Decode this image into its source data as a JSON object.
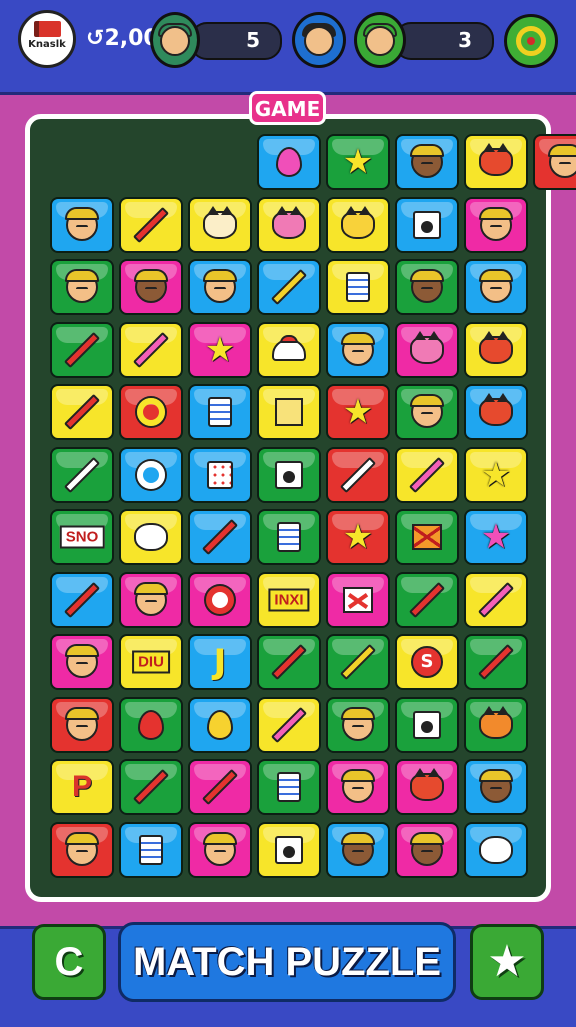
{
  "header": {
    "logo_text": "Knaslk",
    "coin_label": "2,00",
    "player1": {
      "count": "5"
    },
    "player2": {
      "count": "3"
    }
  },
  "game_tag": "GAME",
  "bottom": {
    "left_button": "C",
    "title": "MATCH PUZZLE",
    "right_button": "★"
  },
  "colors": {
    "blue": "#1fa6f0",
    "green": "#1aa13c",
    "yellow": "#f7e52a",
    "pink": "#ef2aa5",
    "red": "#e4332f",
    "board": "#24452c",
    "background": "#c24aa8",
    "bar": "#3949c4"
  },
  "grid": {
    "rows": [
      [
        null,
        null,
        null,
        [
          "blue",
          "drop-pink-icon",
          ""
        ],
        [
          "green",
          "star-icon",
          ""
        ],
        [
          "blue",
          "face-dark-icon",
          ""
        ],
        [
          "yellow",
          "cat-icon",
          ""
        ],
        [
          "red",
          "face-icon",
          ""
        ]
      ],
      [
        [
          "blue",
          "face-icon",
          ""
        ],
        [
          "yellow",
          "pencil-icon",
          ""
        ],
        [
          "yellow",
          "cat-white-icon",
          ""
        ],
        [
          "yellow",
          "cat-pink-icon",
          ""
        ],
        [
          "yellow",
          "cat-yellow-icon",
          ""
        ],
        [
          "blue",
          "box-icon",
          ""
        ],
        [
          "pink",
          "face-icon",
          ""
        ]
      ],
      [
        [
          "green",
          "face-icon",
          ""
        ],
        [
          "pink",
          "face-dark-icon",
          ""
        ],
        [
          "blue",
          "face-icon",
          ""
        ],
        [
          "blue",
          "pencil-yellow-icon",
          ""
        ],
        [
          "yellow",
          "doc-icon",
          ""
        ],
        [
          "green",
          "face-dark-icon",
          ""
        ],
        [
          "blue",
          "face-icon",
          ""
        ]
      ],
      [
        [
          "green",
          "pencil-icon",
          ""
        ],
        [
          "yellow",
          "pencil-pink-icon",
          ""
        ],
        [
          "pink",
          "star-icon",
          ""
        ],
        [
          "yellow",
          "lamp-icon",
          ""
        ],
        [
          "blue",
          "face-icon",
          ""
        ],
        [
          "pink",
          "cat-pink-icon",
          ""
        ],
        [
          "yellow",
          "cat-icon",
          ""
        ]
      ],
      [
        [
          "yellow",
          "pencil-icon",
          ""
        ],
        [
          "red",
          "ring-yellow-icon",
          ""
        ],
        [
          "blue",
          "doc-icon",
          ""
        ],
        [
          "yellow",
          "cube-icon",
          ""
        ],
        [
          "red",
          "star-icon",
          ""
        ],
        [
          "green",
          "face-icon",
          ""
        ],
        [
          "blue",
          "cat-icon",
          ""
        ]
      ],
      [
        [
          "green",
          "pencil-white-icon",
          ""
        ],
        [
          "blue",
          "ring-icon",
          ""
        ],
        [
          "blue",
          "calculator-icon",
          ""
        ],
        [
          "green",
          "box-icon",
          ""
        ],
        [
          "red",
          "pencil-white-icon",
          ""
        ],
        [
          "yellow",
          "pencil-pink-icon",
          ""
        ],
        [
          "yellow",
          "star-icon",
          ""
        ]
      ],
      [
        [
          "green",
          "word-icon",
          "SNO"
        ],
        [
          "yellow",
          "blob-icon",
          ""
        ],
        [
          "blue",
          "pencil-icon",
          ""
        ],
        [
          "green",
          "doc-icon",
          ""
        ],
        [
          "red",
          "star-icon",
          ""
        ],
        [
          "green",
          "flag-icon",
          ""
        ],
        [
          "blue",
          "star-pink-icon",
          ""
        ]
      ],
      [
        [
          "blue",
          "pencil-icon",
          ""
        ],
        [
          "pink",
          "face-icon",
          ""
        ],
        [
          "pink",
          "ring-red-icon",
          ""
        ],
        [
          "yellow",
          "word-icon",
          "INXI"
        ],
        [
          "pink",
          "cross-icon",
          ""
        ],
        [
          "green",
          "pencil-icon",
          ""
        ],
        [
          "yellow",
          "pencil-pink-icon",
          ""
        ]
      ],
      [
        [
          "pink",
          "face-icon",
          ""
        ],
        [
          "yellow",
          "word-icon",
          "DIU"
        ],
        [
          "blue",
          "hook-icon",
          ""
        ],
        [
          "green",
          "pencil-icon",
          ""
        ],
        [
          "green",
          "pencil-yellow-icon",
          ""
        ],
        [
          "yellow",
          "letter-s-icon",
          "S"
        ],
        [
          "green",
          "pencil-icon",
          ""
        ]
      ],
      [
        [
          "red",
          "face-icon",
          ""
        ],
        [
          "green",
          "drop-red-icon",
          ""
        ],
        [
          "blue",
          "drop-icon",
          ""
        ],
        [
          "yellow",
          "pencil-pink-icon",
          ""
        ],
        [
          "green",
          "face-icon",
          ""
        ],
        [
          "green",
          "box-icon",
          ""
        ],
        [
          "green",
          "cat-orange-icon",
          ""
        ]
      ],
      [
        [
          "yellow",
          "letter-p-icon",
          "P"
        ],
        [
          "green",
          "pencil-icon",
          ""
        ],
        [
          "pink",
          "pencil-icon",
          ""
        ],
        [
          "green",
          "doc-icon",
          ""
        ],
        [
          "pink",
          "face-icon",
          ""
        ],
        [
          "pink",
          "cat-icon",
          ""
        ],
        [
          "blue",
          "face-dark-icon",
          ""
        ]
      ],
      [
        [
          "red",
          "face-icon",
          ""
        ],
        [
          "blue",
          "doc-icon",
          ""
        ],
        [
          "pink",
          "face-icon",
          ""
        ],
        [
          "yellow",
          "box-icon",
          ""
        ],
        [
          "blue",
          "face-dark-icon",
          ""
        ],
        [
          "pink",
          "face-dark-icon",
          ""
        ],
        [
          "blue",
          "blob-icon",
          ""
        ]
      ]
    ]
  }
}
